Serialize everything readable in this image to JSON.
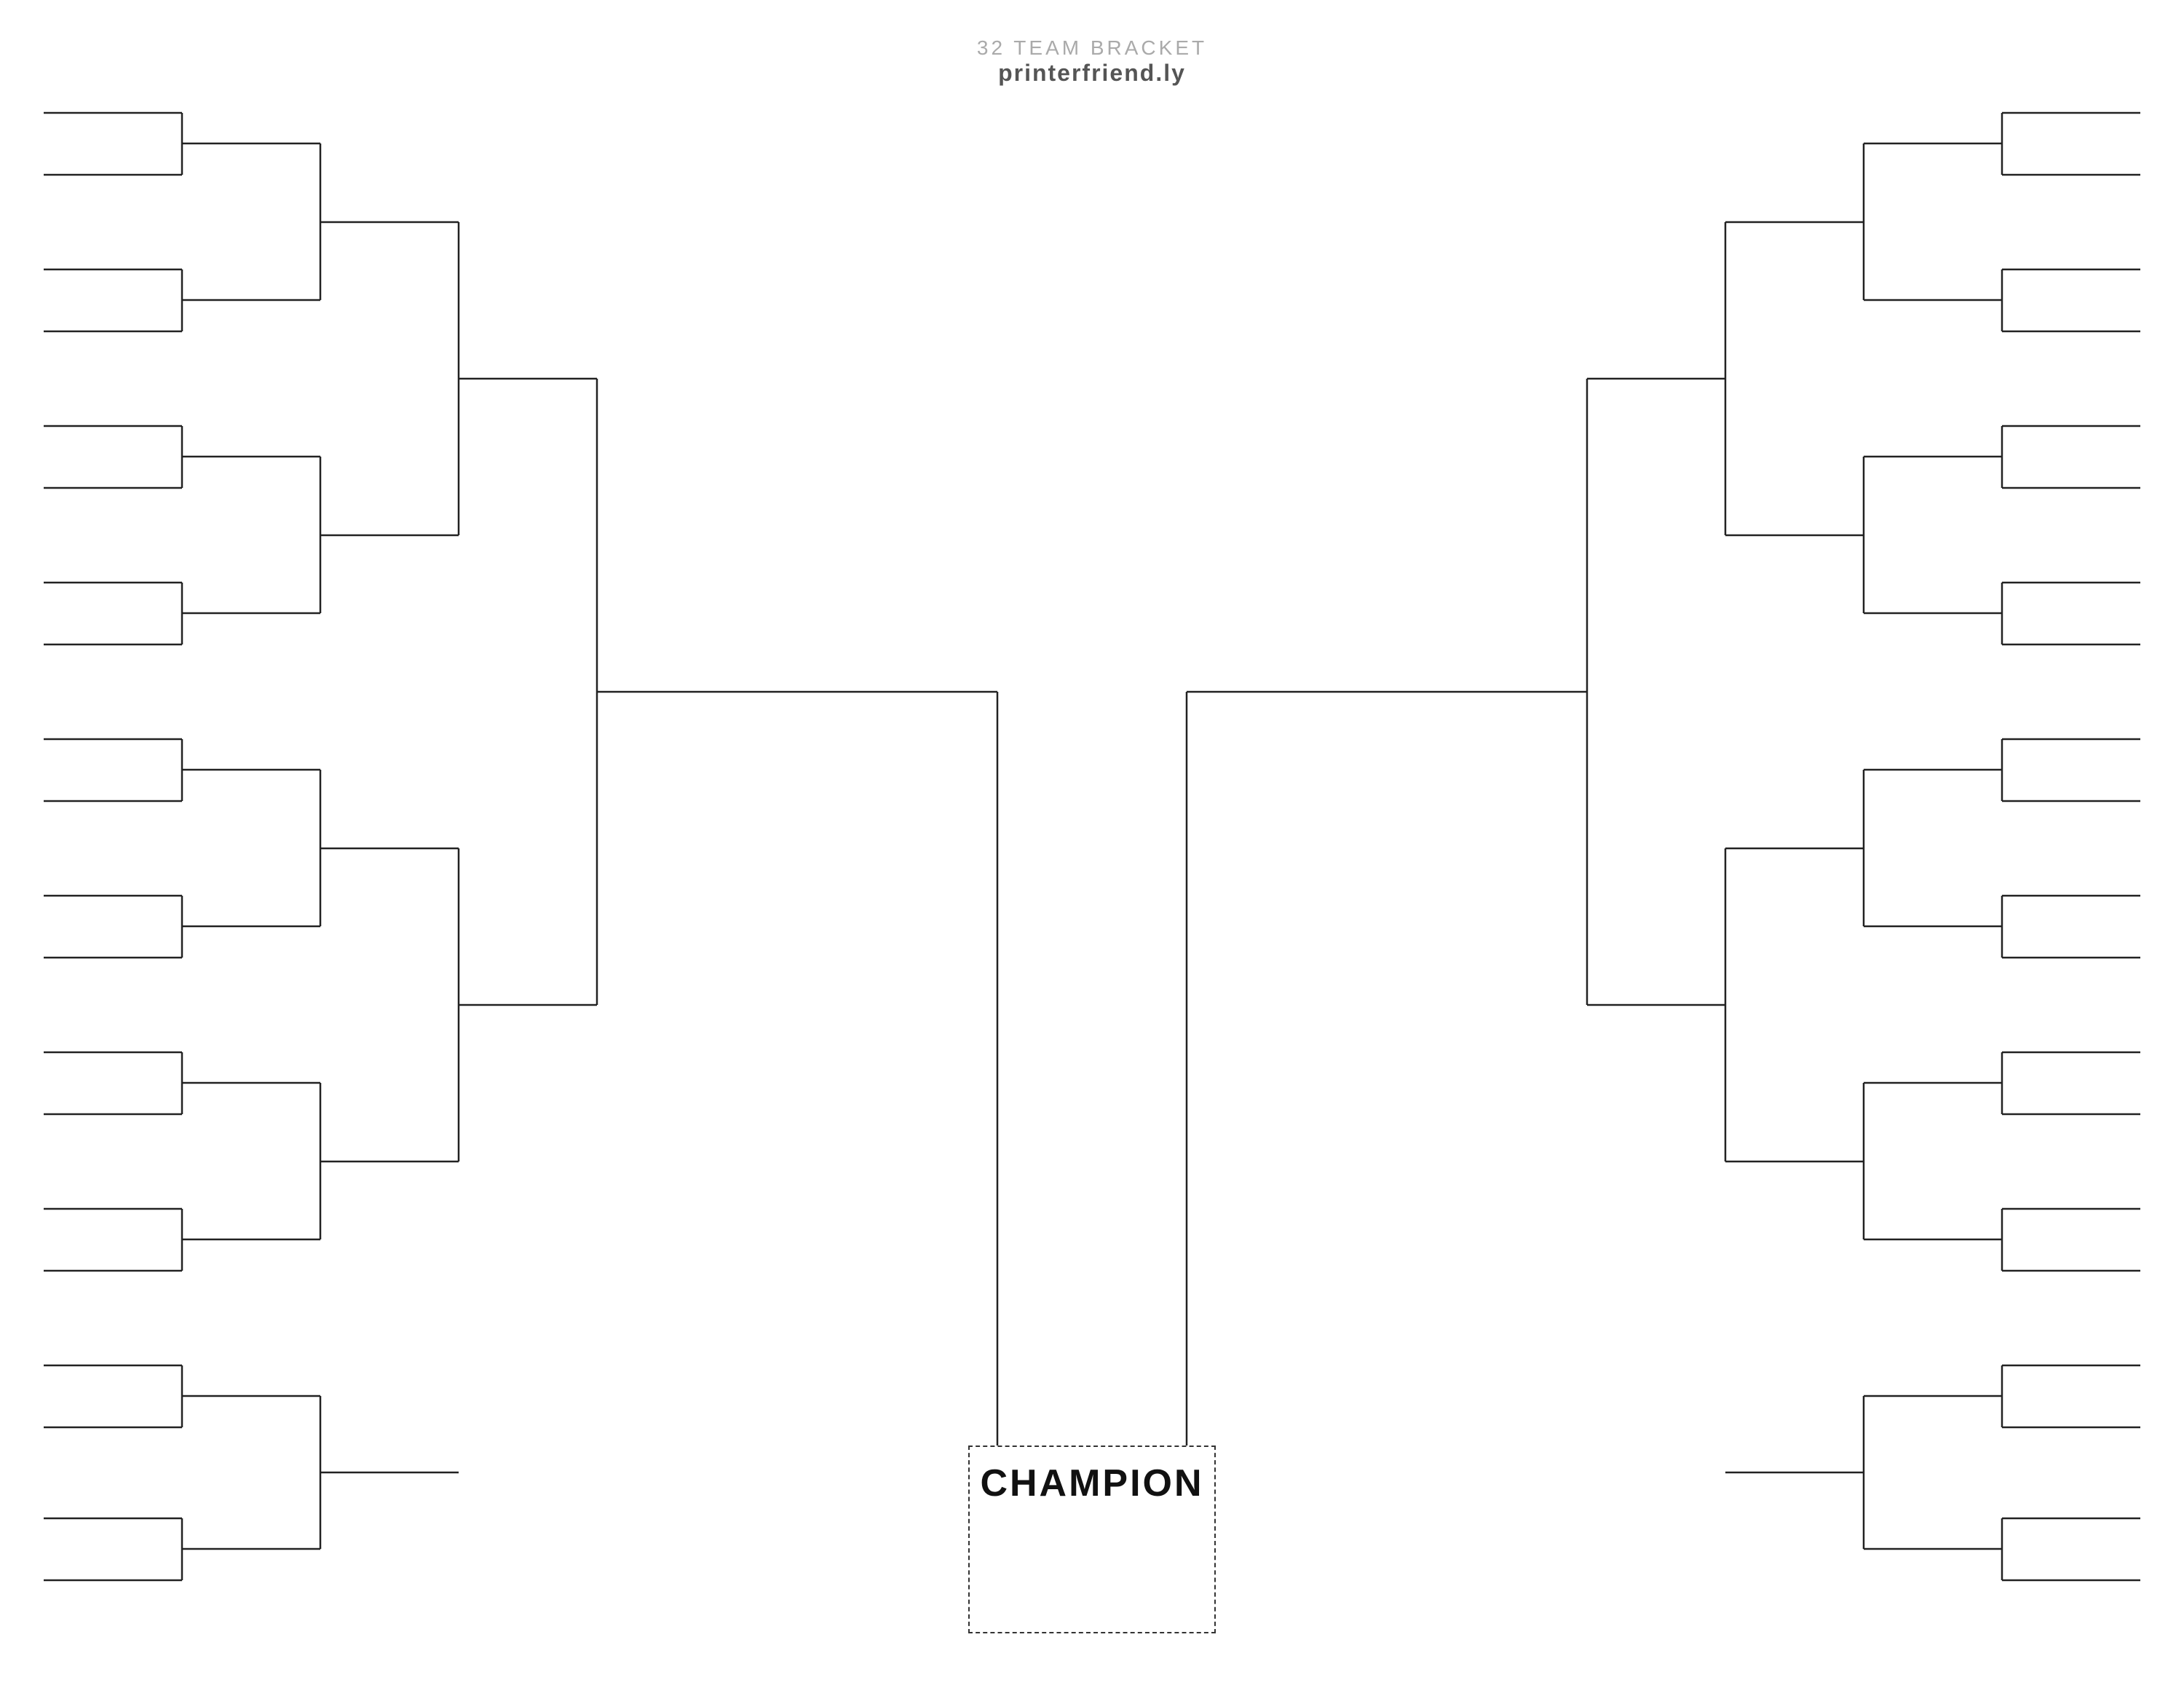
{
  "header": {
    "title": "32 TEAM BRACKET",
    "subtitle": "printerfriend.ly"
  },
  "champion": {
    "label": "CHAMPION"
  },
  "colors": {
    "line": "#222",
    "dashed": "#333",
    "text_light": "#aaa",
    "text_dark": "#555"
  }
}
